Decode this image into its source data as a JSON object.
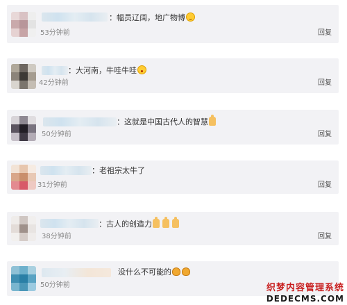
{
  "comments": [
    {
      "text": "：幅员辽阔，地广物博",
      "emoji": "smile",
      "time": "53分钟前",
      "reply": "回复"
    },
    {
      "text": "：大河南，牛哇牛哇",
      "emoji": "wow",
      "time": "42分钟前",
      "reply": "回复"
    },
    {
      "text": "：这就是中国古代人的智慧",
      "emoji": "thumb",
      "time": "50分钟前",
      "reply": "回复"
    },
    {
      "text": "：老祖宗太牛了",
      "emoji": "",
      "time": "31分钟前",
      "reply": "回复"
    },
    {
      "text": "：古人的创造力",
      "emoji": "thumb3",
      "time": "38分钟前",
      "reply": "回复"
    },
    {
      "text": "没什么不可能的",
      "emoji": "clap2",
      "time": "50分钟前",
      "reply": ""
    }
  ],
  "watermark": {
    "cn": "织梦内容管理系统",
    "en": "DEDECMS.COM"
  },
  "colors": {
    "card_bg": "#f2f2f5",
    "watermark_red": "#c81e1e"
  }
}
